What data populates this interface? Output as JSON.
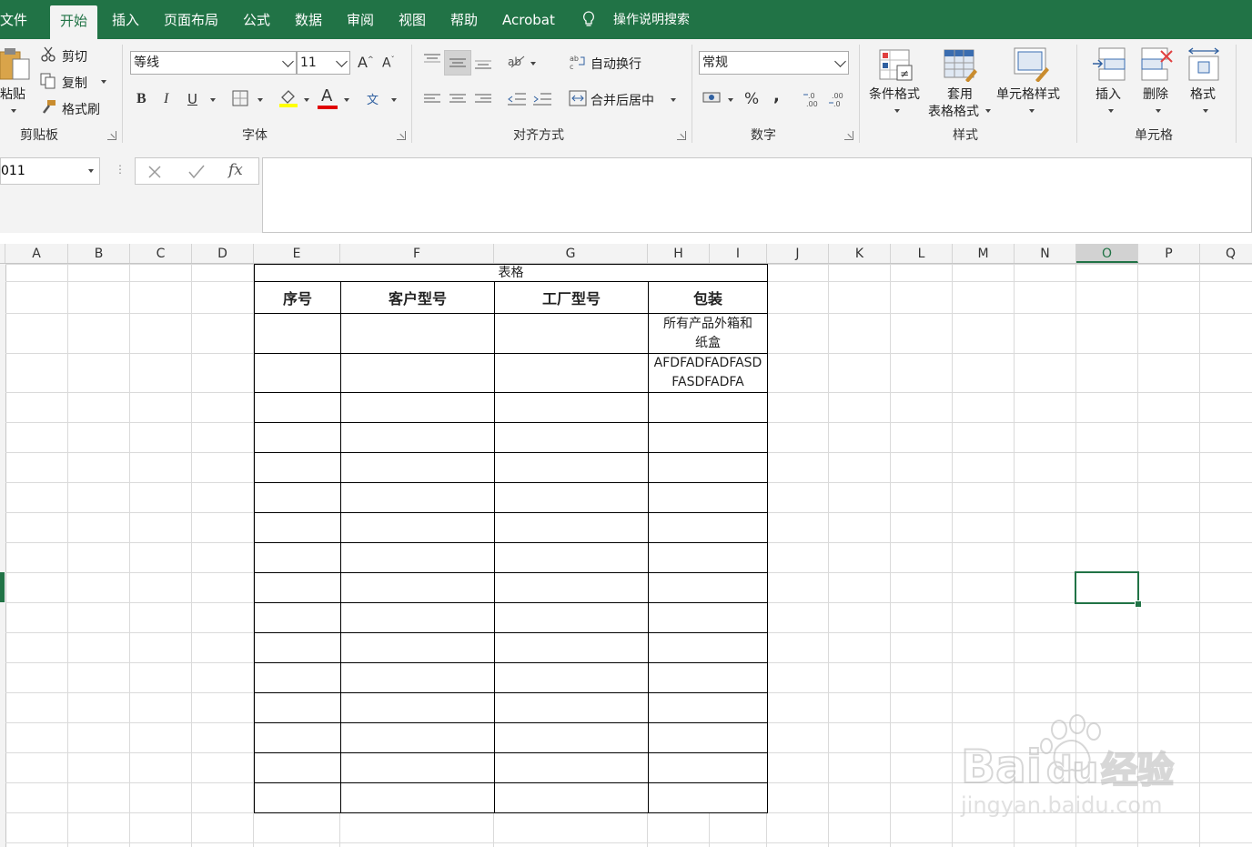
{
  "tabs": [
    {
      "label": "文件",
      "active": false
    },
    {
      "label": "开始",
      "active": true
    },
    {
      "label": "插入",
      "active": false
    },
    {
      "label": "页面布局",
      "active": false
    },
    {
      "label": "公式",
      "active": false
    },
    {
      "label": "数据",
      "active": false
    },
    {
      "label": "审阅",
      "active": false
    },
    {
      "label": "视图",
      "active": false
    },
    {
      "label": "帮助",
      "active": false
    },
    {
      "label": "Acrobat",
      "active": false
    }
  ],
  "search_label": "操作说明搜索",
  "ribbon": {
    "clipboard": {
      "paste": "粘贴",
      "cut": "剪切",
      "copy": "复制",
      "format_painter": "格式刷",
      "label": "剪贴板"
    },
    "font": {
      "name": "等线",
      "size": "11",
      "bold": "B",
      "italic": "I",
      "underline": "U",
      "label": "字体"
    },
    "alignment": {
      "wrap_text": "自动换行",
      "merge_center": "合并后居中",
      "label": "对齐方式"
    },
    "number": {
      "format": "常规",
      "percent": "%",
      "comma": ",",
      "label": "数字"
    },
    "styles": {
      "conditional": "条件格式",
      "table_format_1": "套用",
      "table_format_2": "表格格式",
      "cell_styles": "单元格样式",
      "label": "样式"
    },
    "cells": {
      "insert": "插入",
      "delete": "删除",
      "format": "格式",
      "label": "单元格"
    }
  },
  "namebox": "011",
  "columns": [
    "A",
    "B",
    "C",
    "D",
    "E",
    "F",
    "G",
    "H",
    "I",
    "J",
    "K",
    "L",
    "M",
    "N",
    "O",
    "P",
    "Q"
  ],
  "selected_column": "O",
  "table": {
    "title": "表格",
    "headers": [
      "序号",
      "客户型号",
      "工厂型号",
      "包装"
    ],
    "rows": [
      [
        "",
        "",
        "",
        "所有产品外箱和纸盒"
      ],
      [
        "",
        "",
        "",
        "AFDFADFADFASDFASDFADFA"
      ],
      [
        "",
        "",
        "",
        ""
      ],
      [
        "",
        "",
        "",
        ""
      ],
      [
        "",
        "",
        "",
        ""
      ],
      [
        "",
        "",
        "",
        ""
      ],
      [
        "",
        "",
        "",
        ""
      ],
      [
        "",
        "",
        "",
        ""
      ],
      [
        "",
        "",
        "",
        ""
      ],
      [
        "",
        "",
        "",
        ""
      ],
      [
        "",
        "",
        "",
        ""
      ],
      [
        "",
        "",
        "",
        ""
      ],
      [
        "",
        "",
        "",
        ""
      ],
      [
        "",
        "",
        "",
        ""
      ],
      [
        "",
        "",
        "",
        ""
      ],
      [
        "",
        "",
        "",
        ""
      ]
    ],
    "wrap_lines": [
      [
        "所有产品外箱和",
        "纸盒"
      ],
      [
        "AFDFADFADFASD",
        "FASDFADFA"
      ]
    ]
  },
  "colors": {
    "brand": "#217346",
    "ribbon_bg": "#f3f3f3",
    "grid_line": "#dadada"
  }
}
